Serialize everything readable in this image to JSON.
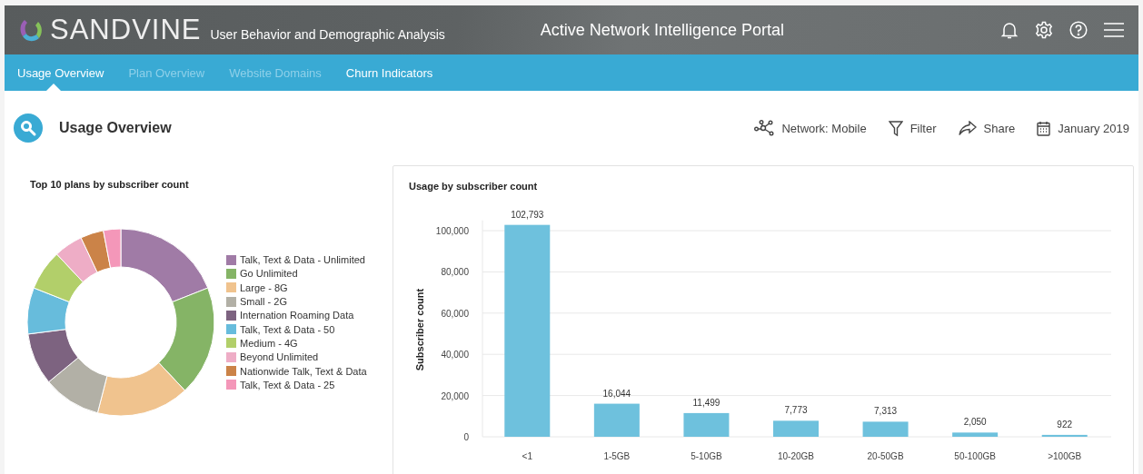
{
  "header": {
    "brand": "SANDVINE",
    "subtitle": "User Behavior and Demographic Analysis",
    "title": "Active Network Intelligence Portal"
  },
  "tabs": [
    {
      "label": "Usage Overview",
      "selected": true,
      "disabled": false
    },
    {
      "label": "Plan Overview",
      "selected": false,
      "disabled": true
    },
    {
      "label": "Website Domains",
      "selected": false,
      "disabled": true
    },
    {
      "label": "Churn Indicators",
      "selected": false,
      "disabled": false
    }
  ],
  "page": {
    "title": "Usage Overview",
    "actions": [
      {
        "kind": "network",
        "label": "Network: Mobile"
      },
      {
        "kind": "filter",
        "label": "Filter"
      },
      {
        "kind": "share",
        "label": "Share"
      },
      {
        "kind": "calendar",
        "label": "January 2019"
      }
    ]
  },
  "plans_panel": {
    "title": "Top 10 plans by subscriber count",
    "legend": [
      {
        "label": "Talk, Text & Data - Unlimited",
        "color": "#a07ba6"
      },
      {
        "label": "Go Unlimited",
        "color": "#85b466"
      },
      {
        "label": "Large - 8G",
        "color": "#f0c38e"
      },
      {
        "label": "Small - 2G",
        "color": "#b2b0a6"
      },
      {
        "label": "Internation Roaming Data",
        "color": "#7d6380"
      },
      {
        "label": "Talk, Text & Data - 50",
        "color": "#67bcdc"
      },
      {
        "label": "Medium - 4G",
        "color": "#b2cf6a"
      },
      {
        "label": "Beyond Unlimited",
        "color": "#eeadc6"
      },
      {
        "label": "Nationwide Talk, Text & Data",
        "color": "#cb8348"
      },
      {
        "label": "Talk, Text & Data - 25",
        "color": "#f497b9"
      }
    ]
  },
  "usage_panel": {
    "title": "Usage by subscriber count",
    "chart_data": {
      "type": "bar",
      "ylabel": "Subscriber count",
      "categories": [
        "<1",
        "1-5GB",
        "5-10GB",
        "10-20GB",
        "20-50GB",
        "50-100GB",
        ">100GB"
      ],
      "values": [
        102793,
        16044,
        11499,
        7773,
        7313,
        2050,
        922
      ],
      "value_labels": [
        "102,793",
        "16,044",
        "11,499",
        "7,773",
        "7,313",
        "2,050",
        "922"
      ],
      "ylim": [
        0,
        105000
      ],
      "grid": true,
      "yticks": [
        {
          "value": 0,
          "label": "0"
        },
        {
          "value": 20000,
          "label": "20,000"
        },
        {
          "value": 40000,
          "label": "40,000"
        },
        {
          "value": 60000,
          "label": "60,000"
        },
        {
          "value": 80000,
          "label": "80,000"
        },
        {
          "value": 100000,
          "label": "100,000"
        }
      ]
    }
  }
}
